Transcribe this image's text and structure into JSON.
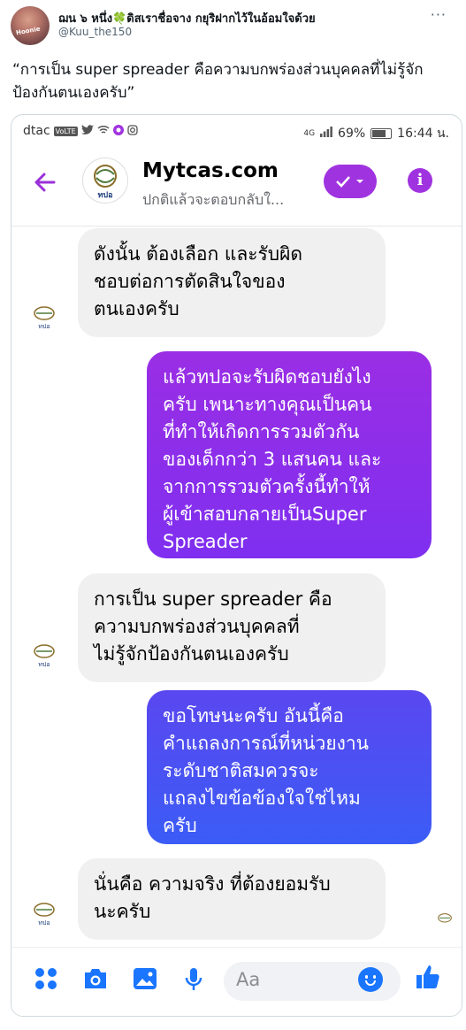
{
  "tweet": {
    "display_name": "ฌน ๖ หนึ่ง🍀ดิสเราชื่อจาง กยุริฝากไว้ในอ้อมใจด้วย",
    "handle": "@Kuu_the150",
    "avatar_tag": "Hoonie",
    "more_label": "···",
    "text": "“การเป็น super spreader คือความบกพร่องส่วนบุคคลที่ไม่รู้จักป้องกันตนเองครับ”"
  },
  "phone": {
    "status_bar": {
      "carrier": "dtac",
      "volte": "VoLTE",
      "signal_label": "4G",
      "battery": "69%",
      "time": "16:44 น."
    },
    "chat_header": {
      "page_name": "Mytcas.com",
      "subtitle": "ปกติแล้วจะตอบกลับใ...",
      "logo_text": "ทปอ"
    },
    "messages": [
      {
        "side": "in",
        "text": "ดังนั้น ต้องเลือก และรับผิดชอบต่อการตัดสินใจของตนเองครับ",
        "lines": [
          "ดังนั้น ต้องเลือก และรับผิด",
          "ชอบต่อการตัดสินใจของ",
          "ตนเองครับ"
        ]
      },
      {
        "side": "out",
        "text": "แล้วทปอจะรับผิดชอบยังไงครับ เพนาะทางคุณเป็นคนที่ทำให้เกิดการรวมตัวกันของเด็กกว่า 3 แสนคน และจากการรวมตัวครั้งนี้ทำให้ผู้เข้าสอบกลายเป็นSuper Spreader",
        "lines": [
          "แล้วทปอจะรับผิดชอบยังไง",
          "ครับ เพนาะทางคุณเป็นคน",
          "ที่ทำให้เกิดการรวมตัวกัน",
          "ของเด็กกว่า 3 แสนคน และ",
          "จากการรวมตัวครั้งนี้ทำให้",
          "ผู้เข้าสอบกลายเป็นSuper",
          "Spreader"
        ]
      },
      {
        "side": "in",
        "text": "การเป็น super spreader คือความบกพร่องส่วนบุคคลที่ไม่รู้จักป้องกันตนเองครับ",
        "lines": [
          "การเป็น super spreader คือ",
          "ความบกพร่องส่วนบุคคลที่",
          "ไม่รู้จักป้องกันตนเองครับ"
        ]
      },
      {
        "side": "out",
        "text": "ขอโทษนะครับ อันนี้คือคำแถลงการณ์ที่หน่วยงานระดับชาติสมควรจะแถลงไขข้อข้องใจใช่ไหมครับ",
        "lines": [
          "ขอโทษนะครับ อันนี้คือ",
          "คำแถลงการณ์ที่หน่วยงาน",
          "ระดับชาติสมควรจะ",
          "แถลงไขข้อข้องใจใช่ไหม",
          "ครับ"
        ]
      },
      {
        "side": "in",
        "text": "นั่นคือ ความจริง ที่ต้องยอมรับนะครับ",
        "lines": [
          "นั่นคือ ความจริง ที่ต้องยอมรับ",
          "นะครับ"
        ]
      }
    ],
    "composer": {
      "placeholder": "Aa",
      "icons": [
        "apps-icon",
        "camera-icon",
        "photo-icon",
        "microphone-icon",
        "emoji-icon",
        "thumbs-up-icon"
      ]
    },
    "colors": {
      "accent": "#a033e0",
      "out_bubble_1": "#8a2be2",
      "out_bubble_2": "#3b5cf6",
      "in_bubble": "#f0f0f0",
      "composer_icon": "#1a75ff"
    }
  }
}
